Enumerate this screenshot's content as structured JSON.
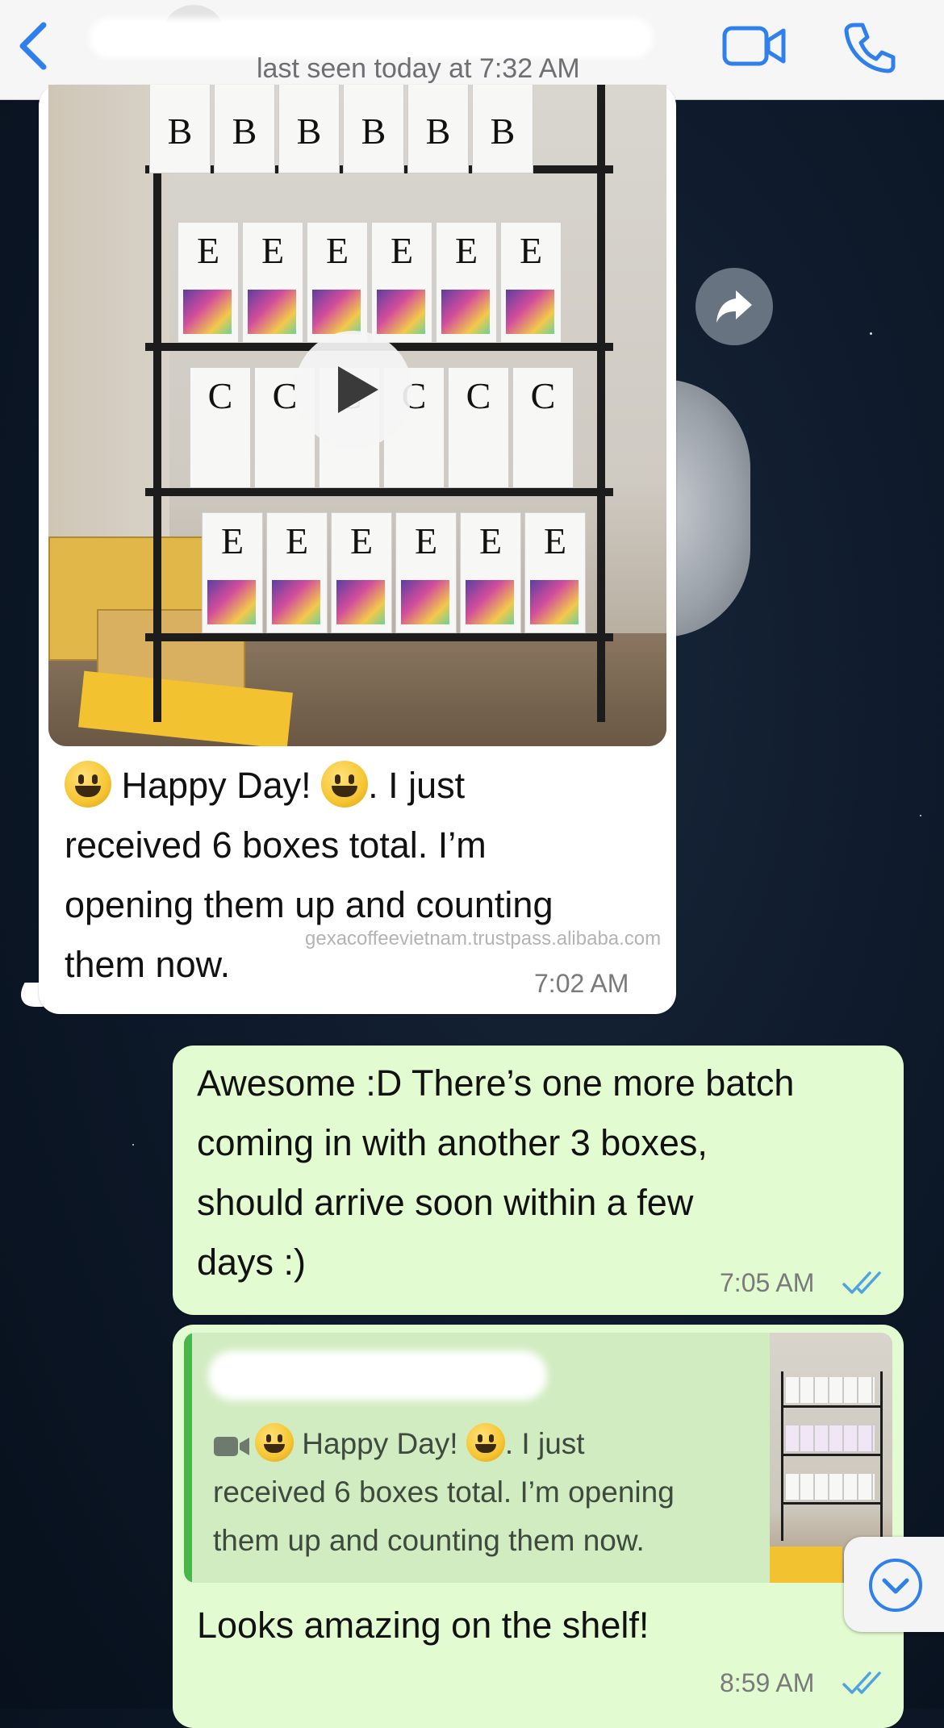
{
  "header": {
    "last_seen": "last seen today at 7:32 AM"
  },
  "messages": {
    "incoming": {
      "text_line1": "Happy Day!",
      "text_line1b": ". I just",
      "text_line2": "received 6 boxes total.  I’m",
      "text_line3": "opening them up and counting",
      "text_line4": "them now.",
      "time": "7:02 AM",
      "watermark": "gexacoffeevietnam.trustpass.alibaba.com"
    },
    "outgoing_1": {
      "text_line1": "Awesome :D There’s one more batch",
      "text_line2": "coming in with another 3 boxes,",
      "text_line3": "should arrive soon within a few",
      "text_line4": "days :)",
      "time": "7:05 AM"
    },
    "outgoing_2": {
      "quote_line1a": "Happy Day!",
      "quote_line1b": ". I just",
      "quote_line2": "received 6 boxes total.  I’m opening",
      "quote_line3": "them up and counting them now.",
      "text": "Looks amazing on the shelf!",
      "time": "8:59 AM"
    }
  },
  "thumb_bags": {
    "row1": [
      "B",
      "B",
      "B",
      "B",
      "B",
      "B"
    ],
    "row2": [
      "E",
      "E",
      "E",
      "E",
      "E",
      "E"
    ],
    "row3": [
      "C",
      "C",
      "C",
      "C",
      "C",
      "C"
    ],
    "row4": [
      "E",
      "E",
      "E",
      "E",
      "E",
      "E"
    ]
  },
  "colors": {
    "accent_blue": "#2f80ed",
    "outgoing_bubble": "#e2fbd0",
    "reply_bar": "#47b74a",
    "read_ticks": "#4fa3e0"
  },
  "icons": [
    "back-chevron-icon",
    "video-call-icon",
    "phone-icon",
    "play-icon",
    "share-icon",
    "camera-icon",
    "double-check-icon",
    "chevron-down-circle-icon"
  ]
}
